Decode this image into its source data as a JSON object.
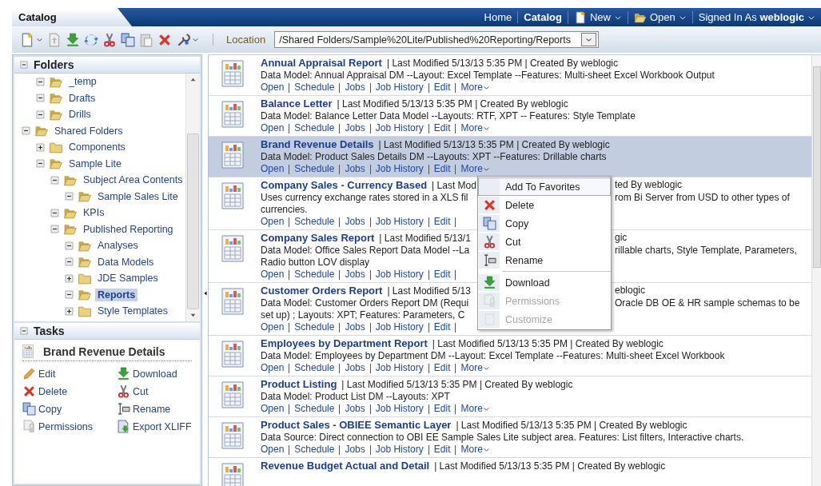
{
  "app_tab": {
    "label": "Catalog"
  },
  "nav": [
    {
      "label": "Home",
      "kind": "link",
      "selected": false
    },
    {
      "label": "Catalog",
      "kind": "link",
      "selected": true
    },
    {
      "label": "New",
      "kind": "menu",
      "selected": false
    },
    {
      "label": "Open",
      "kind": "menu",
      "selected": false
    },
    {
      "label": "Signed In As **weblogic**",
      "kind": "menu",
      "selected": false
    }
  ],
  "location": {
    "label": "Location",
    "value": "/Shared Folders/Sample%20Lite/Published%20Reporting/Reports"
  },
  "folders": {
    "title": "Folders",
    "expanded": true,
    "tree_above": [
      {
        "label": "_temp",
        "expanded": true,
        "selected": false
      },
      {
        "label": "Drafts",
        "expanded": true,
        "selected": false
      },
      {
        "label": "Drills",
        "expanded": true,
        "selected": false
      }
    ],
    "tree": [
      {
        "label": "Shared Folders",
        "expanded": true,
        "selected": false,
        "children": [
          {
            "label": "Components",
            "expanded": false,
            "selected": false
          },
          {
            "label": "Sample Lite",
            "expanded": true,
            "selected": false,
            "children": [
              {
                "label": "Subject Area Contents",
                "expanded": true,
                "selected": false,
                "children": [
                  {
                    "label": "Sample Sales Lite",
                    "expanded": true,
                    "selected": false
                  }
                ]
              },
              {
                "label": "KPIs",
                "expanded": true,
                "selected": false
              },
              {
                "label": "Published Reporting",
                "expanded": true,
                "selected": false,
                "children": [
                  {
                    "label": "Analyses",
                    "expanded": true,
                    "selected": false
                  },
                  {
                    "label": "Data Models",
                    "expanded": true,
                    "selected": false
                  },
                  {
                    "label": "JDE Samples",
                    "expanded": false,
                    "selected": false
                  },
                  {
                    "label": "Reports",
                    "expanded": true,
                    "selected": true
                  },
                  {
                    "label": "Style Templates",
                    "expanded": false,
                    "selected": false
                  }
                ]
              }
            ]
          }
        ]
      }
    ]
  },
  "tasks": {
    "title": "Tasks",
    "expanded": true,
    "object": "Brand Revenue Details",
    "items": [
      "Edit",
      "Download",
      "Delete",
      "Cut",
      "Copy",
      "Rename",
      "Permissions",
      "Export XLIFF"
    ]
  },
  "reports": [
    {
      "title": "Annual Appraisal Report",
      "selected": false,
      "meta": [
        "| Last Modified 5/13/13 5:35 PM | Created By weblogic"
      ],
      "lines": [
        [
          "Data Model: Annual Appraisal DM --Layout: Excel Template --Features: Multi-sheet Excel Workbook Output"
        ]
      ],
      "actions": [
        {
          "label": "Open",
          "kind": "link"
        },
        {
          "label": "Schedule",
          "kind": "link"
        },
        {
          "label": "Jobs",
          "kind": "link"
        },
        {
          "label": "Job History",
          "kind": "link"
        },
        {
          "label": "Edit",
          "kind": "link"
        },
        {
          "label": "More",
          "kind": "menu"
        }
      ]
    },
    {
      "title": "Balance Letter",
      "selected": false,
      "meta": [
        "| Last Modified 5/13/13 5:35 PM | Created By weblogic"
      ],
      "lines": [
        [
          "Data Model: Balance Letter Data Model --Layouts: RTF, XPT -- Features: Style Template"
        ]
      ],
      "actions": [
        {
          "label": "Open",
          "kind": "link"
        },
        {
          "label": "Schedule",
          "kind": "link"
        },
        {
          "label": "Jobs",
          "kind": "link"
        },
        {
          "label": "Job History",
          "kind": "link"
        },
        {
          "label": "Edit",
          "kind": "link"
        },
        {
          "label": "More",
          "kind": "menu"
        }
      ]
    },
    {
      "title": "Brand Revenue Details",
      "selected": true,
      "meta": [
        "| Last Modified 5/13/13 5:35 PM | Created By weblogic"
      ],
      "lines": [
        [
          "Data Model: Product Sales Details DM --Layouts: XPT --Features: Drillable charts"
        ]
      ],
      "actions": [
        {
          "label": "Open",
          "kind": "link"
        },
        {
          "label": "Schedule",
          "kind": "link"
        },
        {
          "label": "Jobs",
          "kind": "link"
        },
        {
          "label": "Job History",
          "kind": "link"
        },
        {
          "label": "Edit",
          "kind": "link"
        },
        {
          "label": "More",
          "kind": "menu"
        }
      ]
    },
    {
      "title": "Company Sales - Currency Based",
      "selected": false,
      "meta": [
        "| Last Mod",
        "ted By weblogic"
      ],
      "lines": [
        [
          "Uses currency exchange rates stored in a XLS fil",
          "rom Bi Server from USD to other types of"
        ],
        [
          "currencies."
        ]
      ],
      "actions": [
        {
          "label": "Open",
          "kind": "link"
        },
        {
          "label": "Schedule",
          "kind": "link"
        },
        {
          "label": "Jobs",
          "kind": "link"
        },
        {
          "label": "Job History",
          "kind": "link"
        },
        {
          "label": "Edit",
          "kind": "link"
        }
      ]
    },
    {
      "title": "Company Sales Report",
      "selected": false,
      "meta": [
        "| Last Modified 5/13/1",
        "gic"
      ],
      "lines": [
        [
          "Data Model: Office Sales Report Data Model --La",
          "rillable charts, Style Template, Parameters,"
        ],
        [
          "Radio button LOV display"
        ]
      ],
      "actions": [
        {
          "label": "Open",
          "kind": "link"
        },
        {
          "label": "Schedule",
          "kind": "link"
        },
        {
          "label": "Jobs",
          "kind": "link"
        },
        {
          "label": "Job History",
          "kind": "link"
        },
        {
          "label": "Edit",
          "kind": "link"
        }
      ]
    },
    {
      "title": "Customer Orders Report",
      "selected": false,
      "meta": [
        "| Last Modified 5/13",
        "eblogic"
      ],
      "lines": [
        [
          "Data Model: Customer Orders Report DM (Requi",
          "Oracle DB OE & HR sample schemas to be"
        ],
        [
          "set up) ; Layouts: XPT; Features: Parameters, C"
        ]
      ],
      "actions": [
        {
          "label": "Open",
          "kind": "link"
        },
        {
          "label": "Schedule",
          "kind": "link"
        },
        {
          "label": "Jobs",
          "kind": "link"
        },
        {
          "label": "Job History",
          "kind": "link"
        },
        {
          "label": "Edit",
          "kind": "link"
        }
      ]
    },
    {
      "title": "Employees by Department Report",
      "selected": false,
      "meta": [
        "| Last Modified 5/13/13 5:35 PM | Created By weblogic"
      ],
      "lines": [
        [
          "Data Model: Employees by Department DM --Layout: Excel Template --Features: Multi-sheet Excel Workbook"
        ]
      ],
      "actions": [
        {
          "label": "Open",
          "kind": "link"
        },
        {
          "label": "Schedule",
          "kind": "link"
        },
        {
          "label": "Jobs",
          "kind": "link"
        },
        {
          "label": "Job History",
          "kind": "link"
        },
        {
          "label": "Edit",
          "kind": "link"
        },
        {
          "label": "More",
          "kind": "menu"
        }
      ]
    },
    {
      "title": "Product Listing",
      "selected": false,
      "meta": [
        "| Last Modified 5/13/13 5:35 PM | Created By weblogic"
      ],
      "lines": [
        [
          "Data Model: Product List DM --Layouts: XPT"
        ]
      ],
      "actions": [
        {
          "label": "Open",
          "kind": "link"
        },
        {
          "label": "Schedule",
          "kind": "link"
        },
        {
          "label": "Jobs",
          "kind": "link"
        },
        {
          "label": "Job History",
          "kind": "link"
        },
        {
          "label": "Edit",
          "kind": "link"
        },
        {
          "label": "More",
          "kind": "menu"
        }
      ]
    },
    {
      "title": "Product Sales - OBIEE Semantic Layer",
      "selected": false,
      "meta": [
        "| Last Modified 5/13/13 5:35 PM | Created By weblogic"
      ],
      "lines": [
        [
          "Data Source: Direct connection to OBI EE Sample Sales Lite subject area. Features: List filters, Interactive charts."
        ]
      ],
      "actions": [
        {
          "label": "Open",
          "kind": "link"
        },
        {
          "label": "Schedule",
          "kind": "link"
        },
        {
          "label": "Jobs",
          "kind": "link"
        },
        {
          "label": "Job History",
          "kind": "link"
        },
        {
          "label": "Edit",
          "kind": "link"
        },
        {
          "label": "More",
          "kind": "menu"
        }
      ]
    },
    {
      "title": "Revenue Budget Actual and Detail",
      "selected": false,
      "meta": [
        "| Last Modified 5/13/13 5:35 PM | Created By weblogic"
      ]
    }
  ],
  "context_menu": [
    {
      "kind": "item",
      "label": "Add To Favorites",
      "selected": true,
      "disabled": false
    },
    {
      "kind": "item",
      "label": "Delete",
      "selected": false,
      "disabled": false
    },
    {
      "kind": "item",
      "label": "Copy",
      "selected": false,
      "disabled": false
    },
    {
      "kind": "item",
      "label": "Cut",
      "selected": false,
      "disabled": false
    },
    {
      "kind": "item",
      "label": "Rename",
      "selected": false,
      "disabled": false
    },
    {
      "kind": "separator"
    },
    {
      "kind": "item",
      "label": "Download",
      "selected": false,
      "disabled": false
    },
    {
      "kind": "item",
      "label": "Permissions",
      "selected": false,
      "disabled": true
    },
    {
      "kind": "item",
      "label": "Customize",
      "selected": false,
      "disabled": true
    }
  ]
}
